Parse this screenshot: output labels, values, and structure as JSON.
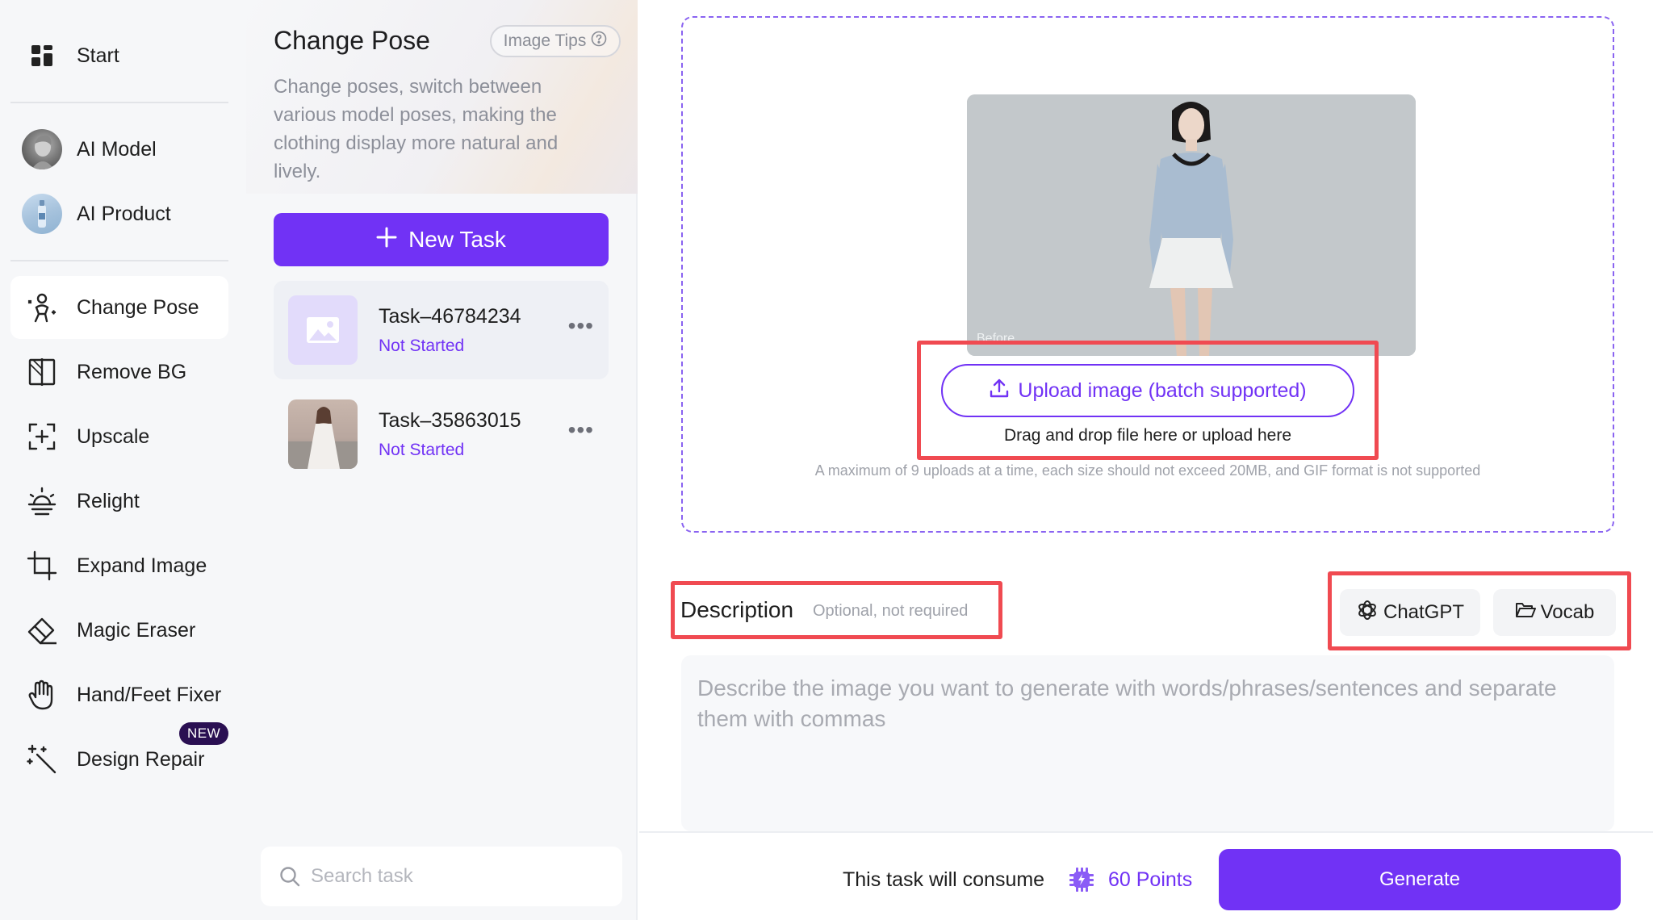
{
  "nav": {
    "items": [
      {
        "label": "Start",
        "icon": "grid-icon"
      },
      {
        "label": "AI Model",
        "icon": "ai-model-avatar"
      },
      {
        "label": "AI Product",
        "icon": "ai-product-avatar"
      },
      {
        "label": "Change Pose",
        "icon": "pose-icon",
        "active": true
      },
      {
        "label": "Remove BG",
        "icon": "remove-bg-icon"
      },
      {
        "label": "Upscale",
        "icon": "upscale-icon"
      },
      {
        "label": "Relight",
        "icon": "relight-icon"
      },
      {
        "label": "Expand Image",
        "icon": "crop-icon"
      },
      {
        "label": "Magic Eraser",
        "icon": "eraser-icon"
      },
      {
        "label": "Hand/Feet Fixer",
        "icon": "hand-icon"
      },
      {
        "label": "Design Repair",
        "icon": "magic-wand-icon",
        "badge": "NEW"
      }
    ]
  },
  "panel": {
    "title": "Change Pose",
    "tips_label": "Image Tips",
    "description": "Change poses, switch between various model poses, making the clothing display more natural and lively.",
    "new_task_label": "New Task",
    "tasks": [
      {
        "name": "Task–46784234",
        "status": "Not Started",
        "thumb": "placeholder-image-icon"
      },
      {
        "name": "Task–35863015",
        "status": "Not Started",
        "thumb": "photo-thumbnail"
      }
    ],
    "search_placeholder": "Search task"
  },
  "main": {
    "preview_caption": "Before",
    "upload_label": "Upload image (batch supported)",
    "drag_text": "Drag and drop file here or upload here",
    "limit_text": "A maximum of 9 uploads at a time, each size should not exceed 20MB, and GIF format is not supported",
    "description_title": "Description",
    "description_optional": "Optional, not required",
    "chatgpt_label": "ChatGPT",
    "vocab_label": "Vocab",
    "description_placeholder": "Describe the image you want to generate with words/phrases/sentences and separate them with commas",
    "consume_text": "This task will consume",
    "points_text": "60 Points",
    "generate_label": "Generate"
  },
  "colors": {
    "accent": "#7132f5",
    "highlight": "#f04a51",
    "badge_bg": "#2a0f52"
  }
}
